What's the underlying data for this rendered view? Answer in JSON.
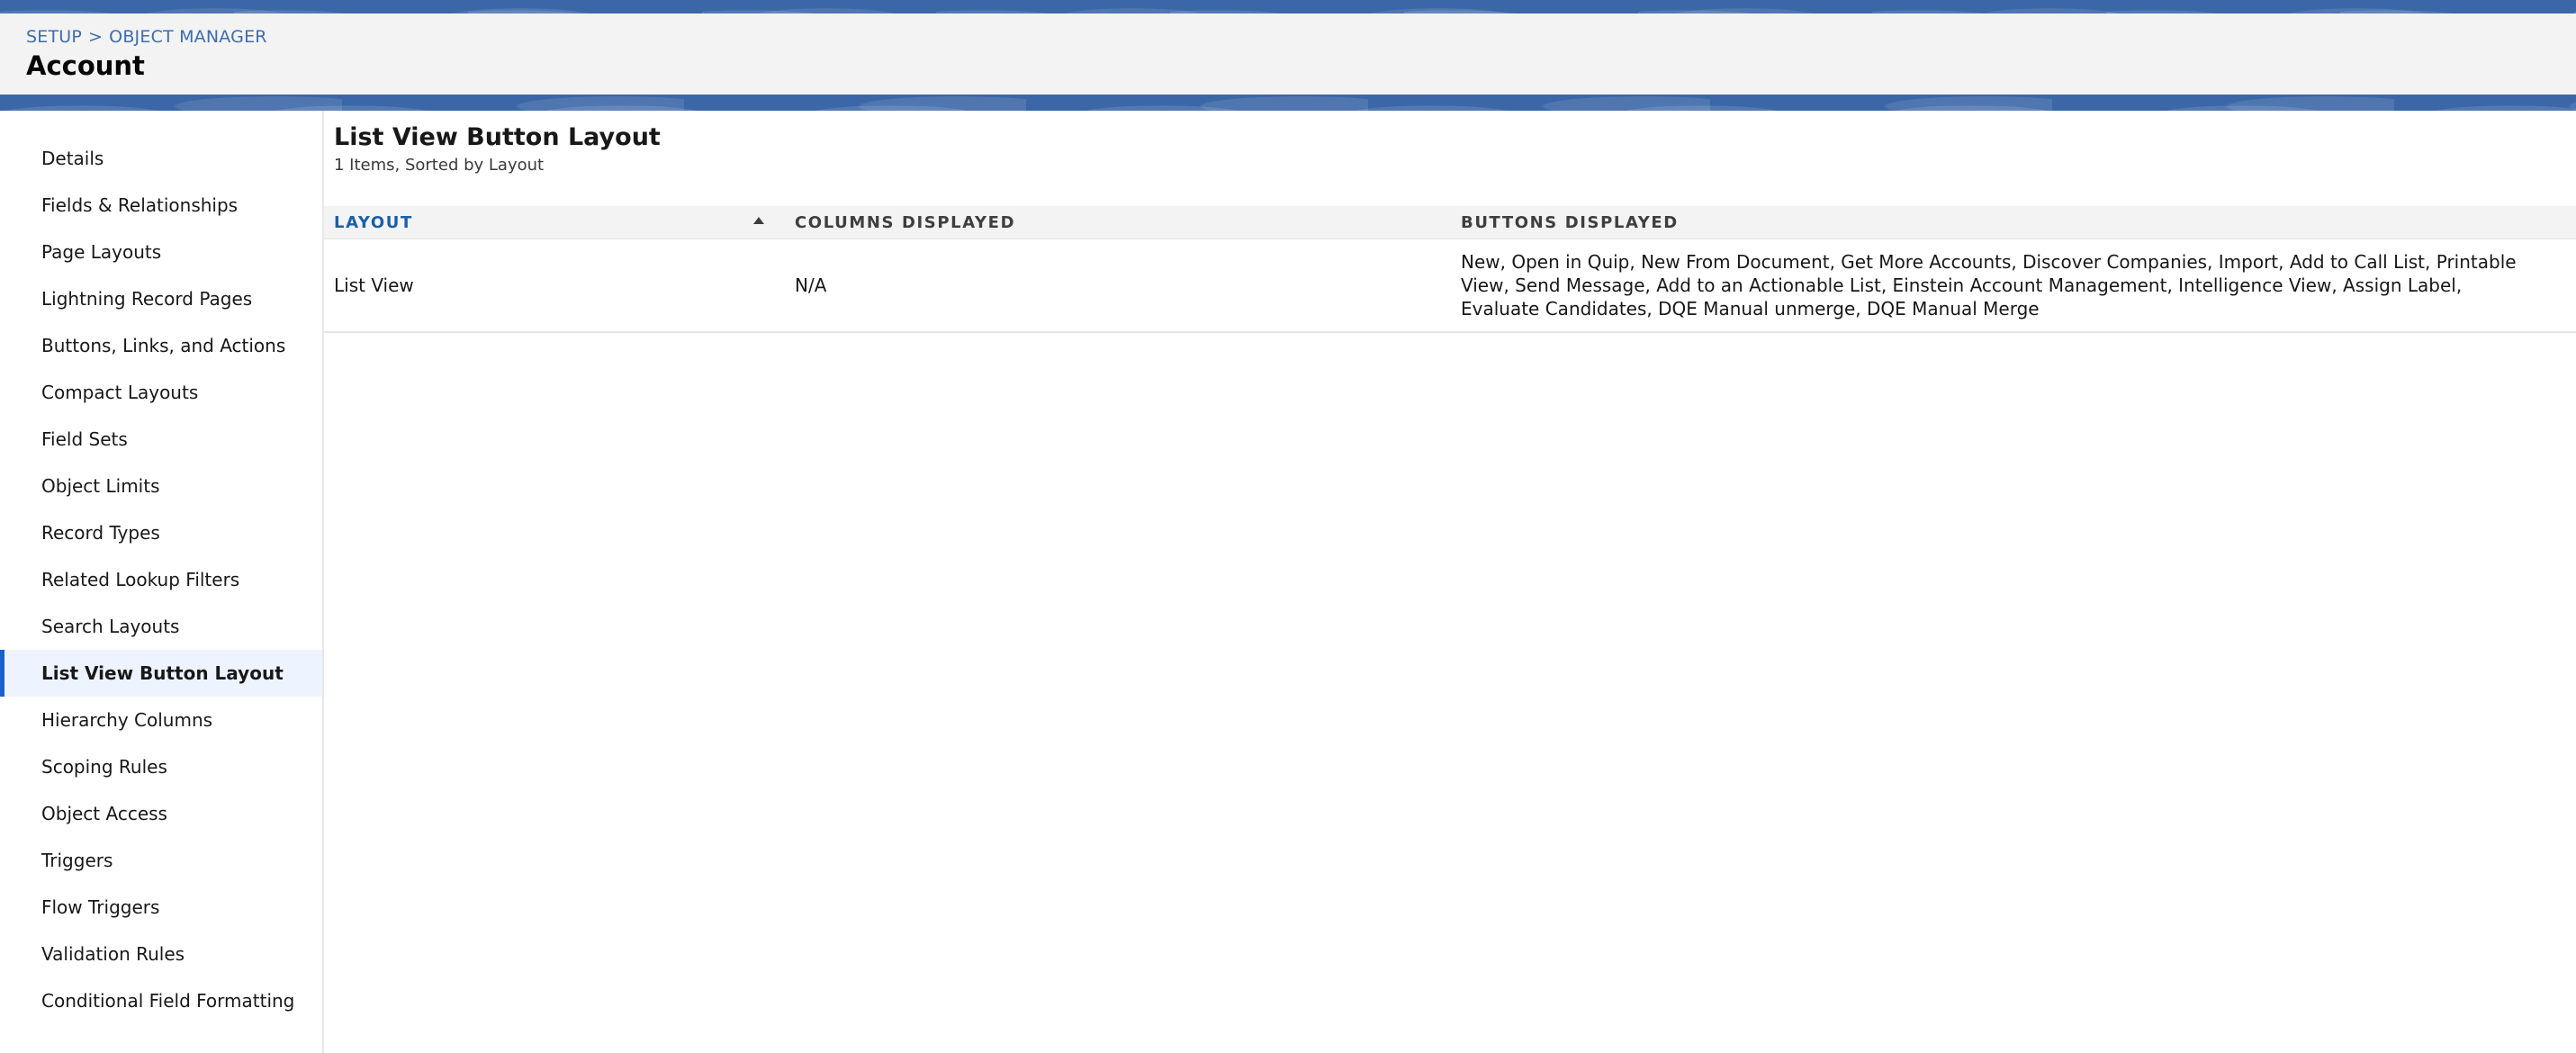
{
  "header": {
    "breadcrumb": [
      "SETUP",
      "OBJECT MANAGER"
    ],
    "breadcrumb_separator": ">",
    "title": "Account"
  },
  "sidebar": {
    "items": [
      {
        "label": "Details"
      },
      {
        "label": "Fields & Relationships"
      },
      {
        "label": "Page Layouts"
      },
      {
        "label": "Lightning Record Pages"
      },
      {
        "label": "Buttons, Links, and Actions"
      },
      {
        "label": "Compact Layouts"
      },
      {
        "label": "Field Sets"
      },
      {
        "label": "Object Limits"
      },
      {
        "label": "Record Types"
      },
      {
        "label": "Related Lookup Filters"
      },
      {
        "label": "Search Layouts"
      },
      {
        "label": "List View Button Layout",
        "active": true
      },
      {
        "label": "Hierarchy Columns"
      },
      {
        "label": "Scoping Rules"
      },
      {
        "label": "Object Access"
      },
      {
        "label": "Triggers"
      },
      {
        "label": "Flow Triggers"
      },
      {
        "label": "Validation Rules"
      },
      {
        "label": "Conditional Field Formatting"
      }
    ]
  },
  "main": {
    "title": "List View Button Layout",
    "subtitle": "1 Items, Sorted by Layout",
    "table": {
      "columns": [
        "LAYOUT",
        "COLUMNS DISPLAYED",
        "BUTTONS DISPLAYED"
      ],
      "sorted_column": "LAYOUT",
      "sort_icon": "sort-ascending-icon",
      "rows": [
        {
          "layout": "List View",
          "columns_displayed": "N/A",
          "buttons_displayed": "New, Open in Quip, New From Document, Get More Accounts, Discover Companies, Import, Add to Call List, Printable View, Send Message, Add to an Actionable List, Einstein Account Management, Intelligence View, Assign Label, Evaluate Candidates, DQE Manual unmerge, DQE Manual Merge"
        }
      ]
    }
  },
  "colors": {
    "brand_band": "#3b67a8",
    "link": "#3e6cb0",
    "active_accent": "#1b5fcf",
    "active_bg": "#eef4ff",
    "header_bg": "#f3f3f3"
  }
}
